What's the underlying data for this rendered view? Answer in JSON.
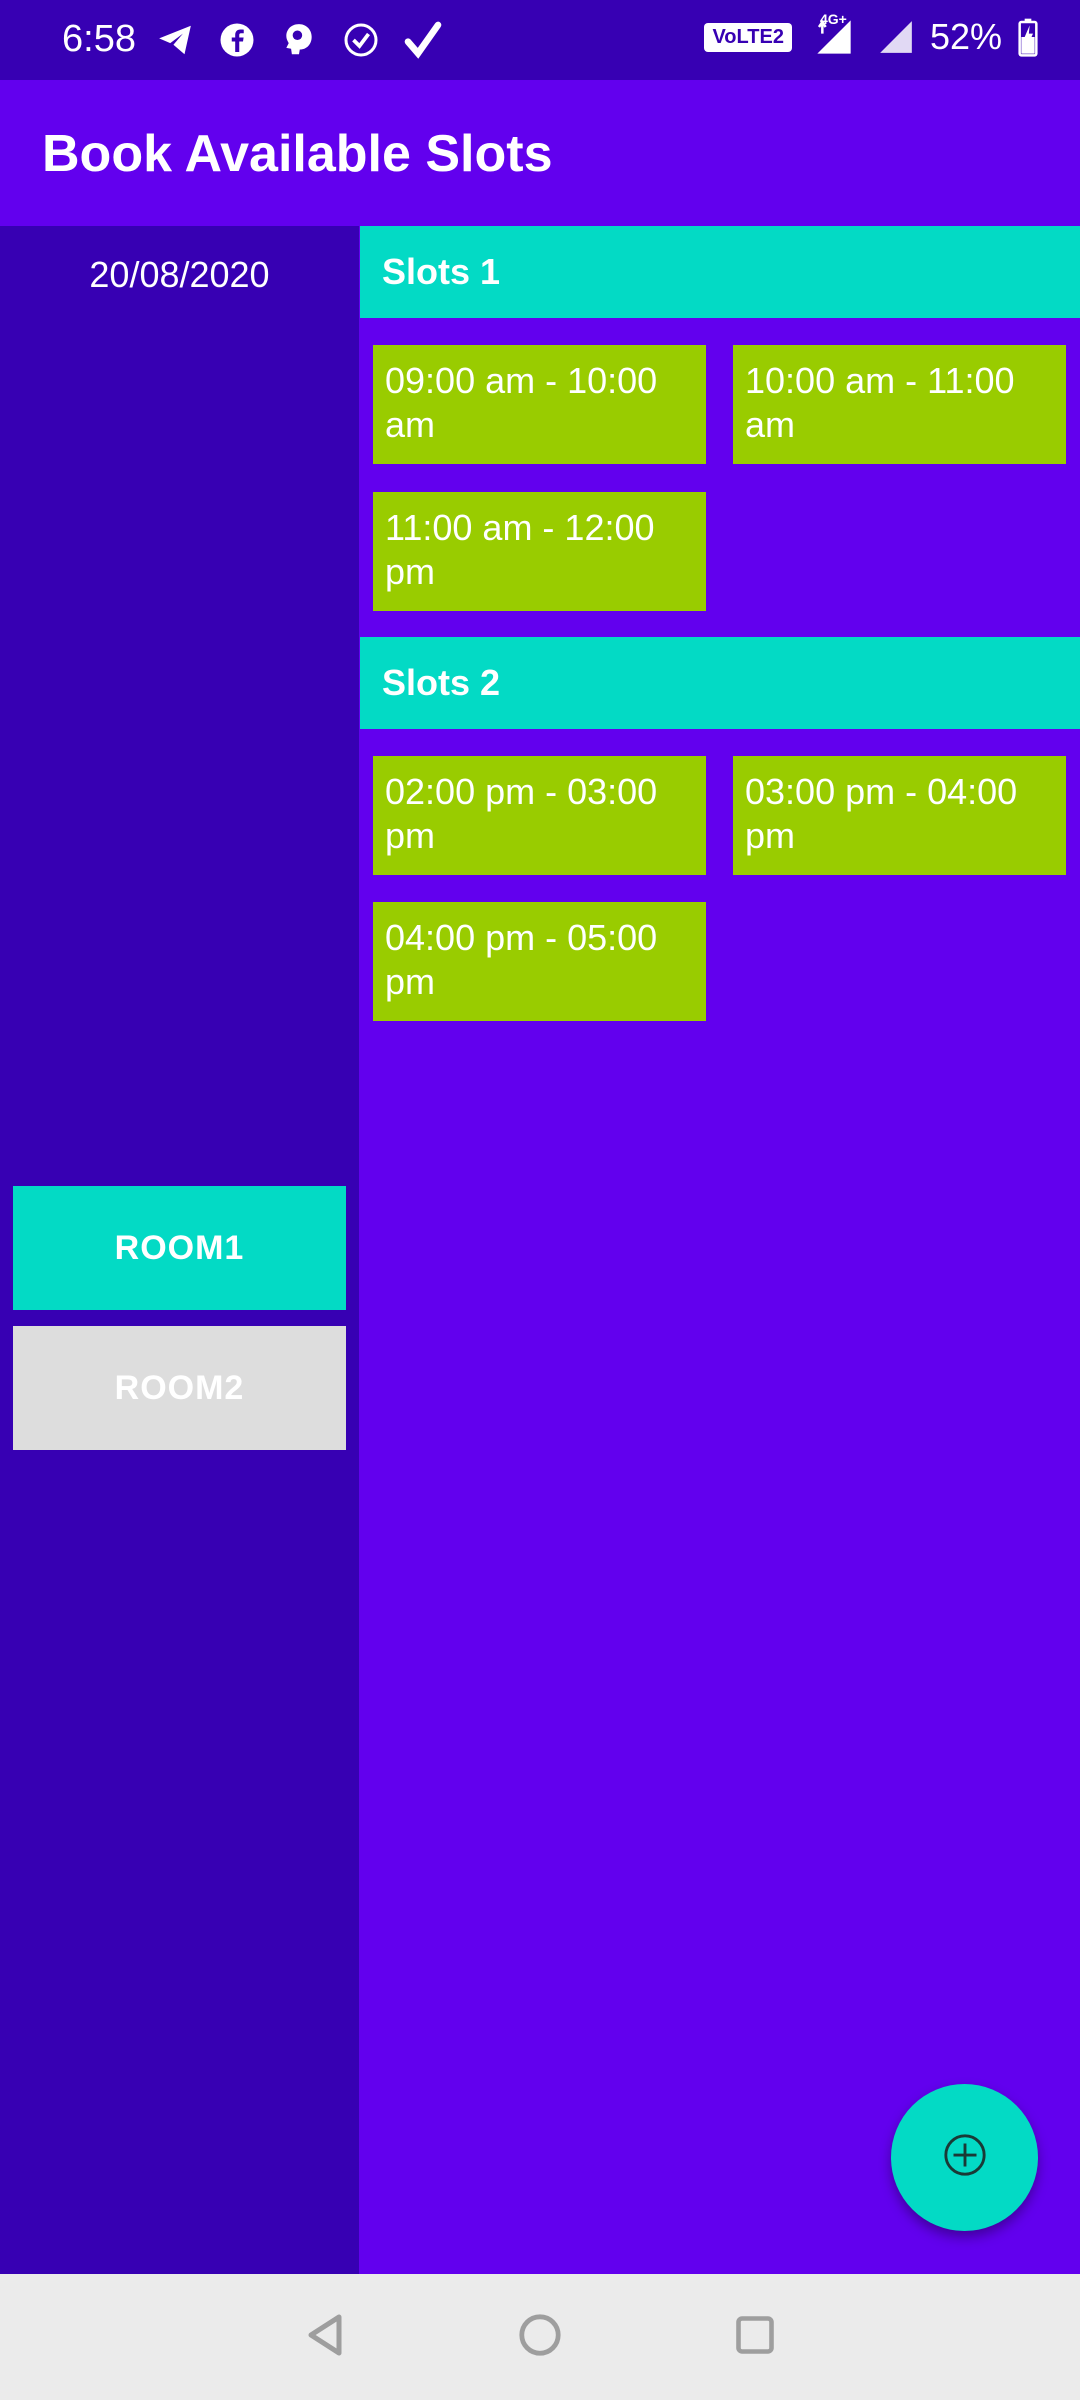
{
  "status_bar": {
    "time": "6:58",
    "network_badge": "VoLTE2",
    "network_type": "4G+",
    "battery_percent": "52%",
    "icons_left": [
      "telegram-icon",
      "facebook-icon",
      "brain-app-icon",
      "check-circle-icon",
      "checkmark-icon"
    ]
  },
  "app_bar": {
    "title": "Book Available Slots"
  },
  "left_panel": {
    "date": "20/08/2020",
    "rooms": [
      {
        "label": "ROOM1",
        "selected": true
      },
      {
        "label": "ROOM2",
        "selected": false
      }
    ]
  },
  "sections": [
    {
      "title": "Slots 1",
      "slots": [
        {
          "line1": "09:00 am - 10:00",
          "line2": "am"
        },
        {
          "line1": "10:00 am - 11:00",
          "line2": "am"
        },
        {
          "line1": "11:00 am - 12:00",
          "line2": "pm"
        }
      ]
    },
    {
      "title": "Slots 2",
      "slots": [
        {
          "line1": "02:00 pm - 03:00",
          "line2": "pm"
        },
        {
          "line1": "03:00 pm - 04:00",
          "line2": "pm"
        },
        {
          "line1": "04:00 pm - 05:00",
          "line2": "pm"
        }
      ]
    }
  ],
  "fab": {
    "icon": "add-circle-icon"
  },
  "nav_bar": {
    "icons": [
      "back-icon",
      "home-icon",
      "recents-icon"
    ]
  },
  "colors": {
    "primary": "#6200EE",
    "primary_dark": "#3700B3",
    "accent": "#03DAC5",
    "slot": "#99CC00",
    "inactive": "#DDDDDD"
  }
}
